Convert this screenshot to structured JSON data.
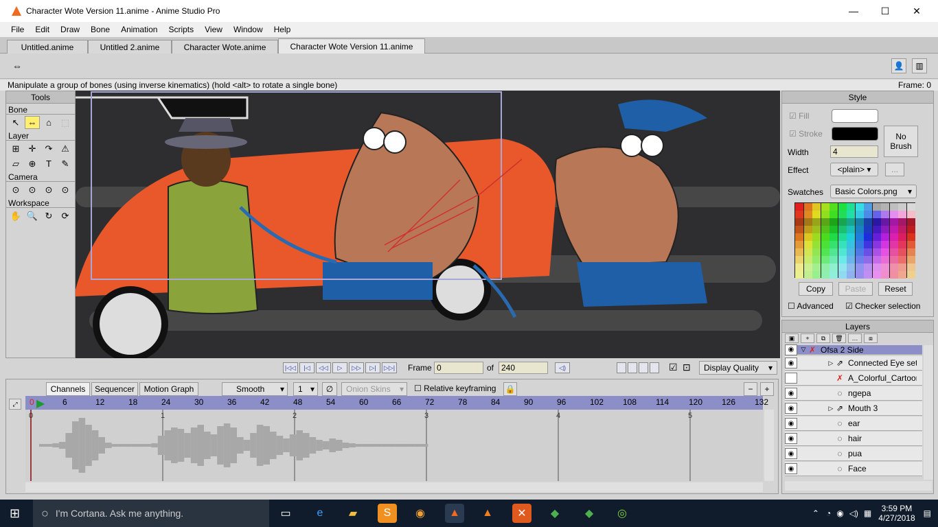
{
  "window": {
    "title": "Character Wote Version 11.anime - Anime Studio Pro",
    "minimize": "—",
    "maximize": "☐",
    "close": "✕"
  },
  "menu": [
    "File",
    "Edit",
    "Draw",
    "Bone",
    "Animation",
    "Scripts",
    "View",
    "Window",
    "Help"
  ],
  "doc_tabs": [
    "Untitled.anime",
    "Untitled 2.anime",
    "Character Wote.anime",
    "Character Wote Version 11.anime"
  ],
  "status": {
    "hint": "Manipulate a group of bones (using inverse kinematics) (hold <alt> to rotate a single bone)",
    "frame": "Frame: 0"
  },
  "tools": {
    "header": "Tools",
    "sections": [
      "Bone",
      "Layer",
      "Camera",
      "Workspace"
    ]
  },
  "style": {
    "header": "Style",
    "fill_label": "Fill",
    "stroke_label": "Stroke",
    "width_label": "Width",
    "width_value": "4",
    "effect_label": "Effect",
    "effect_value": "<plain>",
    "effect_more": "...",
    "no_brush": "No Brush",
    "swatches_label": "Swatches",
    "swatches_value": "Basic Colors.png",
    "copy": "Copy",
    "paste": "Paste",
    "reset": "Reset",
    "advanced": "Advanced",
    "checker": "Checker selection",
    "fill_color": "#ffffff",
    "stroke_color": "#000000"
  },
  "layers": {
    "header": "Layers",
    "items": [
      {
        "name": "Ofsa 2 Side",
        "selected": true
      },
      {
        "name": "Connected Eye set"
      },
      {
        "name": "A_Colorful_Cartoon"
      },
      {
        "name": "ngepa"
      },
      {
        "name": "Mouth 3"
      },
      {
        "name": "ear"
      },
      {
        "name": "hair"
      },
      {
        "name": "pua"
      },
      {
        "name": "Face"
      }
    ]
  },
  "playback": {
    "frame_label": "Frame",
    "frame_value": "0",
    "of_label": "of",
    "total": "240",
    "quality": "Display Quality"
  },
  "timeline": {
    "tabs": [
      "Channels",
      "Sequencer",
      "Motion Graph"
    ],
    "interp": "Smooth",
    "interp_num": "1",
    "onion": "Onion Skins",
    "relative": "Relative keyframing",
    "ruler": [
      "0",
      "6",
      "12",
      "18",
      "24",
      "30",
      "36",
      "42",
      "48",
      "54",
      "60",
      "66",
      "72",
      "78",
      "84",
      "90",
      "96",
      "102",
      "108",
      "114",
      "120",
      "126",
      "132"
    ],
    "seconds": [
      "0",
      "1",
      "2",
      "3",
      "4",
      "5"
    ]
  },
  "taskbar": {
    "cortana": "I'm Cortana. Ask me anything.",
    "time": "3:59 PM",
    "date": "4/27/2018"
  }
}
